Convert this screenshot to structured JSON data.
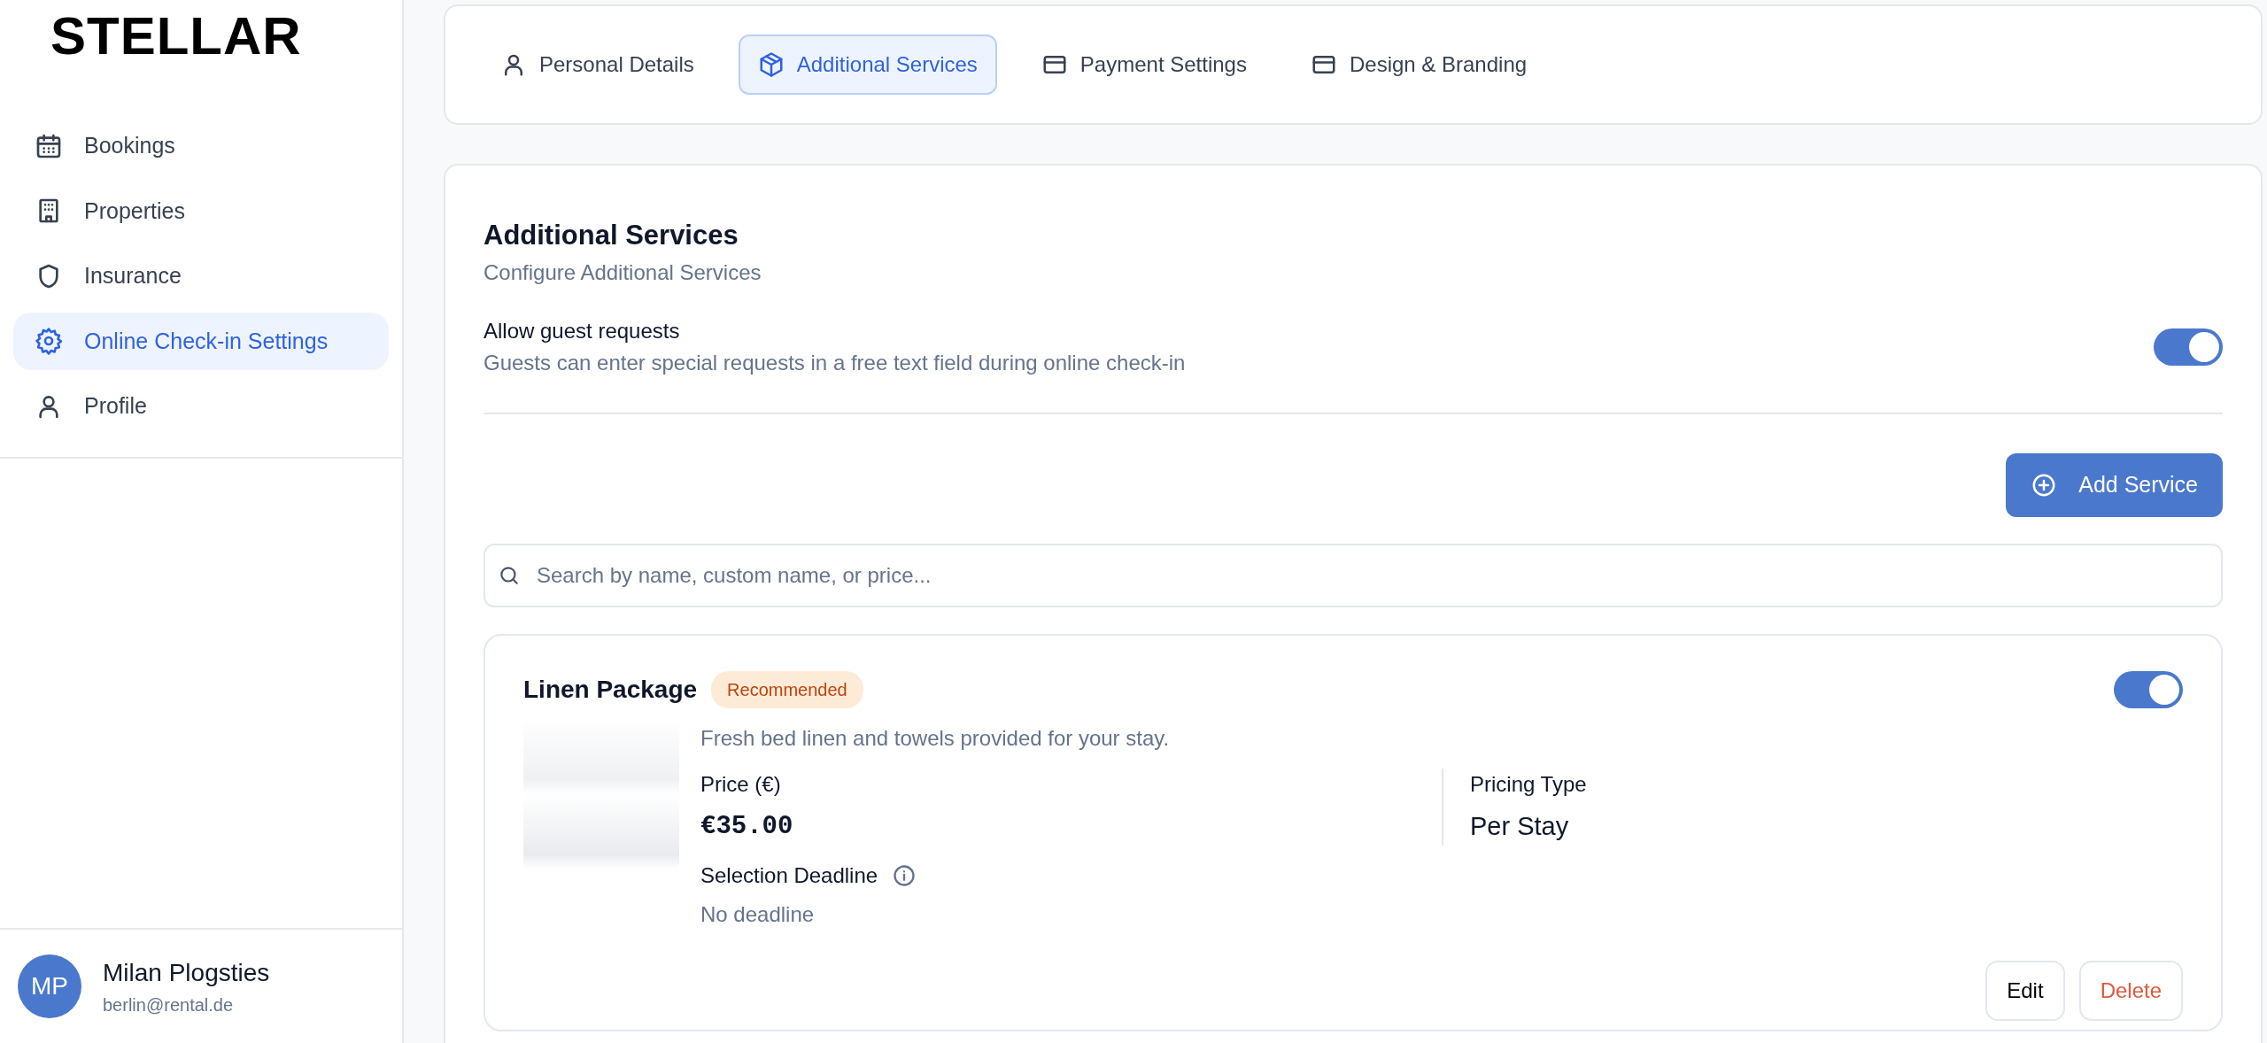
{
  "logo": {
    "text": "STELLAR"
  },
  "sidebar": {
    "items": [
      {
        "label": "Bookings",
        "selected": false
      },
      {
        "label": "Properties",
        "selected": false
      },
      {
        "label": "Insurance",
        "selected": false
      },
      {
        "label": "Online Check-in Settings",
        "selected": true
      },
      {
        "label": "Profile",
        "selected": false
      }
    ]
  },
  "user": {
    "initials": "MP",
    "name": "Milan Plogsties",
    "email": "berlin@rental.de"
  },
  "tabs": [
    {
      "label": "Personal Details",
      "selected": false
    },
    {
      "label": "Additional Services",
      "selected": true
    },
    {
      "label": "Payment Settings",
      "selected": false
    },
    {
      "label": "Design & Branding",
      "selected": false
    }
  ],
  "section": {
    "title": "Additional Services",
    "subtitle": "Configure Additional Services",
    "setting": {
      "label": "Allow guest requests",
      "description": "Guests can enter special requests in a free text field during online check-in",
      "on": true
    },
    "add_button": "Add Service",
    "search": {
      "placeholder": "Search by name, custom name, or price..."
    },
    "services": [
      {
        "name": "Linen Package",
        "badge": "Recommended",
        "on": true,
        "description": "Fresh bed linen and towels provided for your stay.",
        "price_label": "Price (€)",
        "price": "€35.00",
        "pricing_type_label": "Pricing Type",
        "pricing_type": "Per Stay",
        "deadline_label": "Selection Deadline",
        "deadline": "No deadline",
        "buttons": [
          "Edit",
          "Delete"
        ]
      }
    ]
  }
}
